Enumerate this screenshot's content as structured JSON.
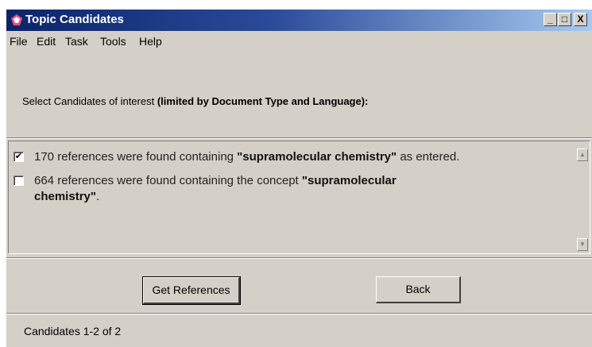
{
  "window": {
    "title": "Topic Candidates",
    "controls": {
      "minimize": "_",
      "maximize": "□",
      "close": "X"
    }
  },
  "menu": {
    "items": [
      "File",
      "Edit",
      "Task",
      "Tools",
      "Help"
    ]
  },
  "instruction": {
    "prefix": "Select Candidates of interest ",
    "bold": "(limited by Document Type and  Language):"
  },
  "candidates": [
    {
      "checked": true,
      "pre": "170 references were found containing ",
      "term": "\"supramolecular chemistry\"",
      "post": " as entered."
    },
    {
      "checked": false,
      "pre": "664 references were found containing the concept ",
      "term_line1": "\"supramolecular",
      "term_line2": "chemistry\"",
      "post": "."
    }
  ],
  "buttons": {
    "get_references": "Get References",
    "back": "Back"
  },
  "status": "Candidates 1-2 of 2"
}
